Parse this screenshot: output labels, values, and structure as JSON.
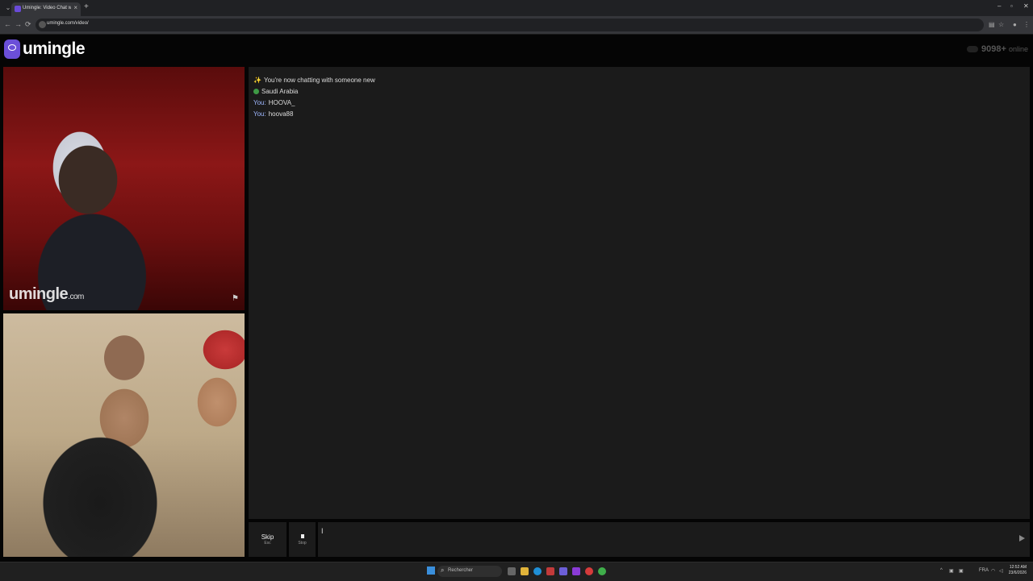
{
  "browser": {
    "tab_title": "Umingle: Video Chat with S",
    "tab_close": "×",
    "new_tab": "+",
    "url": "umingle.com/video/",
    "window": {
      "minimize": "–",
      "maximize": "▫",
      "close": "✕"
    },
    "nav": {
      "back": "←",
      "forward": "→",
      "reload": "⟳"
    }
  },
  "site": {
    "logo_text": "umingle",
    "online_count": "9098+",
    "online_suffix": "online"
  },
  "video": {
    "watermark_text": "umingle",
    "watermark_suffix": ".com",
    "flag_icon": "flag-icon"
  },
  "chat": {
    "messages": [
      {
        "prefix": "✨",
        "text": "You're now chatting with someone new"
      },
      {
        "prefix": "",
        "text": "Saudi Arabia"
      },
      {
        "prefix": "You:",
        "text": "HOOVA_"
      },
      {
        "prefix": "You:",
        "text": "hoova88"
      }
    ]
  },
  "controls": {
    "skip_label": "Skip",
    "skip_hint": "Esc",
    "stop_label": "Stop",
    "caret": "I"
  },
  "taskbar": {
    "search_placeholder": "Rechercher",
    "language": "FRA",
    "time": "12:52 AM",
    "date": "23/6/2026",
    "colors": {
      "start": "#3a8fdc",
      "accent": "#6b4fd8"
    }
  }
}
